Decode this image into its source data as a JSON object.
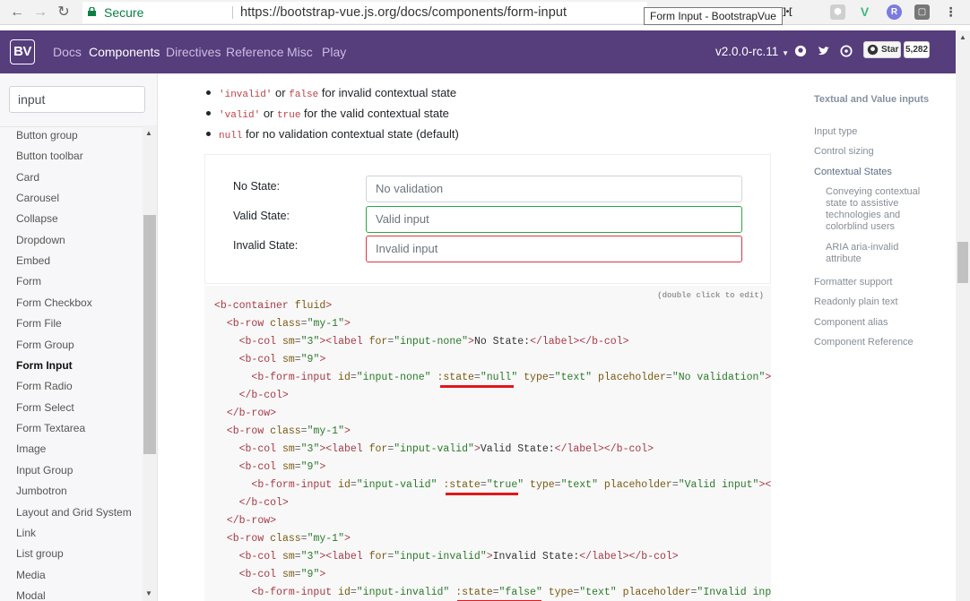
{
  "browser": {
    "secure_label": "Secure",
    "url": "https://bootstrap-vue.js.org/docs/components/form-input",
    "tooltip": "Form Input - BootstrapVue"
  },
  "navbar": {
    "brand": "BV",
    "links": [
      "Docs",
      "Components",
      "Directives",
      "Reference",
      "Misc",
      "Play"
    ],
    "active_link": "Components",
    "version": "v2.0.0-rc.11",
    "star_label": "Star",
    "star_count": "5,282",
    "bg_color": "#563d7c"
  },
  "sidebar": {
    "search_value": "input",
    "items": [
      "Button group",
      "Button toolbar",
      "Card",
      "Carousel",
      "Collapse",
      "Dropdown",
      "Embed",
      "Form",
      "Form Checkbox",
      "Form File",
      "Form Group",
      "Form Input",
      "Form Radio",
      "Form Select",
      "Form Textarea",
      "Image",
      "Input Group",
      "Jumbotron",
      "Layout and Grid System",
      "Link",
      "List group",
      "Media",
      "Modal"
    ],
    "active_item": "Form Input"
  },
  "content": {
    "bullets": [
      {
        "code": "'invalid'",
        "mid": " or ",
        "code2": "false",
        "text": " for invalid contextual state"
      },
      {
        "code": "'valid'",
        "mid": " or ",
        "code2": "true",
        "text": " for the valid contextual state"
      },
      {
        "code": "null",
        "mid": "",
        "code2": "",
        "text": " for no validation contextual state (default)"
      }
    ],
    "demo": {
      "rows": [
        {
          "label": "No State:",
          "placeholder": "No validation"
        },
        {
          "label": "Valid State:",
          "placeholder": "Valid input"
        },
        {
          "label": "Invalid State:",
          "placeholder": "Invalid input"
        }
      ]
    },
    "code_hint": "(double click to edit)"
  },
  "toc": {
    "items": [
      "Textual and Value inputs",
      "Input type",
      "Control sizing",
      "Contextual States",
      "Conveying contextual state to assistive technologies and colorblind users",
      "ARIA aria-invalid attribute",
      "Formatter support",
      "Readonly plain text",
      "Component alias",
      "Component Reference"
    ]
  }
}
